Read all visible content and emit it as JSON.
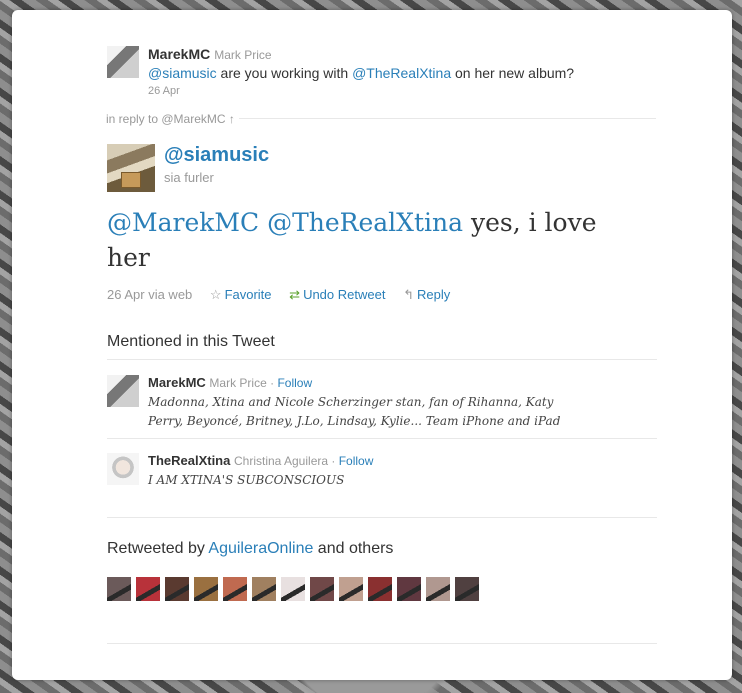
{
  "parent_tweet": {
    "username": "MarekMC",
    "realname": "Mark Price",
    "text_prefix": "@siamusic",
    "text_mid": " are you working with ",
    "mention": "@TheRealXtina",
    "text_suffix": " on her new album?",
    "date": "26 Apr"
  },
  "reply_to": "in reply to @MarekMC ↑",
  "main_tweet": {
    "username": "@siamusic",
    "realname": "sia furler",
    "mention1": "@MarekMC",
    "mention2": "@TheRealXtina",
    "text_rest": " yes, i love her",
    "meta": "26 Apr via web",
    "favorite_label": "Favorite",
    "undo_retweet_label": "Undo Retweet",
    "reply_label": "Reply"
  },
  "mentioned": {
    "title": "Mentioned in this Tweet",
    "users": [
      {
        "username": "MarekMC",
        "realname": "Mark Price",
        "sep": " · ",
        "follow": "Follow",
        "bio_line1": "Madonna, Xtina and Nicole Scherzinger stan, fan of Rihanna, Katy",
        "bio_line2": "Perry, Beyoncé, Britney, J.Lo, Lindsay, Kylie... Team iPhone and iPad"
      },
      {
        "username": "TheRealXtina",
        "realname": "Christina Aguilera",
        "sep": " · ",
        "follow": "Follow",
        "bio_line1": "I AM XTINA'S SUBCONSCIOUS"
      }
    ]
  },
  "retweeted": {
    "prefix": "Retweeted by ",
    "user": "AguileraOnline",
    "suffix": " and others",
    "thumb_colors": [
      "#6b5a5a",
      "#b8323a",
      "#5a3a30",
      "#9a7040",
      "#c06a50",
      "#a08060",
      "#e8e0e0",
      "#704848",
      "#c0a090",
      "#8a3030",
      "#603840",
      "#b09890",
      "#504040"
    ]
  },
  "colors": {
    "link": "#2a7fb8",
    "retweet_icon": "#5ba02b"
  },
  "icons": {
    "favorite": "star-outline-icon",
    "retweet": "retweet-icon",
    "reply": "reply-arrow-icon"
  }
}
